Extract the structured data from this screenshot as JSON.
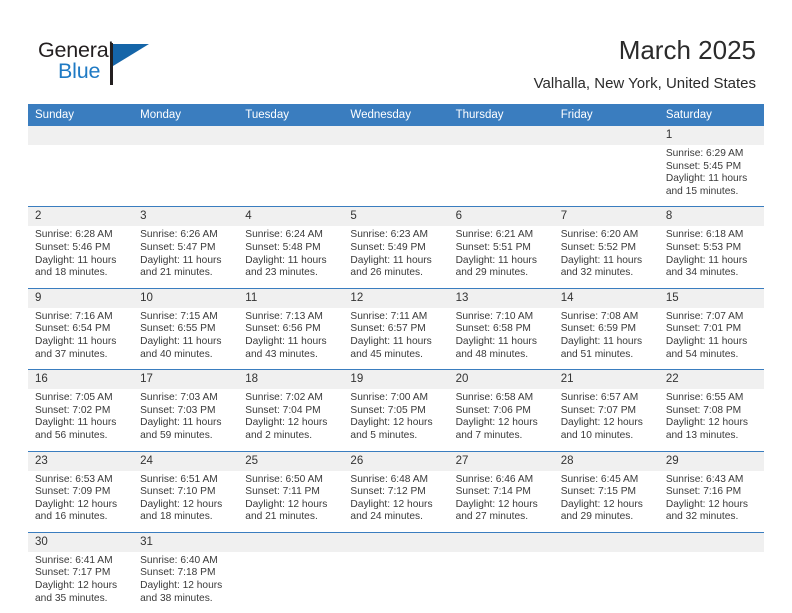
{
  "brand": {
    "name_top": "General",
    "name_bottom": "Blue",
    "accent_color": "#1f7ac4",
    "sail_icon": "sail-triangle-icon"
  },
  "header": {
    "title": "March 2025",
    "subtitle": "Valhalla, New York, United States"
  },
  "colors": {
    "header_row_bg": "#3a7dbf",
    "daynum_bg": "#f0f0f0",
    "text": "#3a3a3a",
    "grid_line": "#3a7dbf"
  },
  "calendar": {
    "weekday_headers": [
      "Sunday",
      "Monday",
      "Tuesday",
      "Wednesday",
      "Thursday",
      "Friday",
      "Saturday"
    ],
    "weeks": [
      [
        {
          "day": "",
          "empty": true
        },
        {
          "day": "",
          "empty": true
        },
        {
          "day": "",
          "empty": true
        },
        {
          "day": "",
          "empty": true
        },
        {
          "day": "",
          "empty": true
        },
        {
          "day": "",
          "empty": true
        },
        {
          "day": "1",
          "sunrise": "Sunrise: 6:29 AM",
          "sunset": "Sunset: 5:45 PM",
          "daylight": "Daylight: 11 hours and 15 minutes."
        }
      ],
      [
        {
          "day": "2",
          "sunrise": "Sunrise: 6:28 AM",
          "sunset": "Sunset: 5:46 PM",
          "daylight": "Daylight: 11 hours and 18 minutes."
        },
        {
          "day": "3",
          "sunrise": "Sunrise: 6:26 AM",
          "sunset": "Sunset: 5:47 PM",
          "daylight": "Daylight: 11 hours and 21 minutes."
        },
        {
          "day": "4",
          "sunrise": "Sunrise: 6:24 AM",
          "sunset": "Sunset: 5:48 PM",
          "daylight": "Daylight: 11 hours and 23 minutes."
        },
        {
          "day": "5",
          "sunrise": "Sunrise: 6:23 AM",
          "sunset": "Sunset: 5:49 PM",
          "daylight": "Daylight: 11 hours and 26 minutes."
        },
        {
          "day": "6",
          "sunrise": "Sunrise: 6:21 AM",
          "sunset": "Sunset: 5:51 PM",
          "daylight": "Daylight: 11 hours and 29 minutes."
        },
        {
          "day": "7",
          "sunrise": "Sunrise: 6:20 AM",
          "sunset": "Sunset: 5:52 PM",
          "daylight": "Daylight: 11 hours and 32 minutes."
        },
        {
          "day": "8",
          "sunrise": "Sunrise: 6:18 AM",
          "sunset": "Sunset: 5:53 PM",
          "daylight": "Daylight: 11 hours and 34 minutes."
        }
      ],
      [
        {
          "day": "9",
          "sunrise": "Sunrise: 7:16 AM",
          "sunset": "Sunset: 6:54 PM",
          "daylight": "Daylight: 11 hours and 37 minutes."
        },
        {
          "day": "10",
          "sunrise": "Sunrise: 7:15 AM",
          "sunset": "Sunset: 6:55 PM",
          "daylight": "Daylight: 11 hours and 40 minutes."
        },
        {
          "day": "11",
          "sunrise": "Sunrise: 7:13 AM",
          "sunset": "Sunset: 6:56 PM",
          "daylight": "Daylight: 11 hours and 43 minutes."
        },
        {
          "day": "12",
          "sunrise": "Sunrise: 7:11 AM",
          "sunset": "Sunset: 6:57 PM",
          "daylight": "Daylight: 11 hours and 45 minutes."
        },
        {
          "day": "13",
          "sunrise": "Sunrise: 7:10 AM",
          "sunset": "Sunset: 6:58 PM",
          "daylight": "Daylight: 11 hours and 48 minutes."
        },
        {
          "day": "14",
          "sunrise": "Sunrise: 7:08 AM",
          "sunset": "Sunset: 6:59 PM",
          "daylight": "Daylight: 11 hours and 51 minutes."
        },
        {
          "day": "15",
          "sunrise": "Sunrise: 7:07 AM",
          "sunset": "Sunset: 7:01 PM",
          "daylight": "Daylight: 11 hours and 54 minutes."
        }
      ],
      [
        {
          "day": "16",
          "sunrise": "Sunrise: 7:05 AM",
          "sunset": "Sunset: 7:02 PM",
          "daylight": "Daylight: 11 hours and 56 minutes."
        },
        {
          "day": "17",
          "sunrise": "Sunrise: 7:03 AM",
          "sunset": "Sunset: 7:03 PM",
          "daylight": "Daylight: 11 hours and 59 minutes."
        },
        {
          "day": "18",
          "sunrise": "Sunrise: 7:02 AM",
          "sunset": "Sunset: 7:04 PM",
          "daylight": "Daylight: 12 hours and 2 minutes."
        },
        {
          "day": "19",
          "sunrise": "Sunrise: 7:00 AM",
          "sunset": "Sunset: 7:05 PM",
          "daylight": "Daylight: 12 hours and 5 minutes."
        },
        {
          "day": "20",
          "sunrise": "Sunrise: 6:58 AM",
          "sunset": "Sunset: 7:06 PM",
          "daylight": "Daylight: 12 hours and 7 minutes."
        },
        {
          "day": "21",
          "sunrise": "Sunrise: 6:57 AM",
          "sunset": "Sunset: 7:07 PM",
          "daylight": "Daylight: 12 hours and 10 minutes."
        },
        {
          "day": "22",
          "sunrise": "Sunrise: 6:55 AM",
          "sunset": "Sunset: 7:08 PM",
          "daylight": "Daylight: 12 hours and 13 minutes."
        }
      ],
      [
        {
          "day": "23",
          "sunrise": "Sunrise: 6:53 AM",
          "sunset": "Sunset: 7:09 PM",
          "daylight": "Daylight: 12 hours and 16 minutes."
        },
        {
          "day": "24",
          "sunrise": "Sunrise: 6:51 AM",
          "sunset": "Sunset: 7:10 PM",
          "daylight": "Daylight: 12 hours and 18 minutes."
        },
        {
          "day": "25",
          "sunrise": "Sunrise: 6:50 AM",
          "sunset": "Sunset: 7:11 PM",
          "daylight": "Daylight: 12 hours and 21 minutes."
        },
        {
          "day": "26",
          "sunrise": "Sunrise: 6:48 AM",
          "sunset": "Sunset: 7:12 PM",
          "daylight": "Daylight: 12 hours and 24 minutes."
        },
        {
          "day": "27",
          "sunrise": "Sunrise: 6:46 AM",
          "sunset": "Sunset: 7:14 PM",
          "daylight": "Daylight: 12 hours and 27 minutes."
        },
        {
          "day": "28",
          "sunrise": "Sunrise: 6:45 AM",
          "sunset": "Sunset: 7:15 PM",
          "daylight": "Daylight: 12 hours and 29 minutes."
        },
        {
          "day": "29",
          "sunrise": "Sunrise: 6:43 AM",
          "sunset": "Sunset: 7:16 PM",
          "daylight": "Daylight: 12 hours and 32 minutes."
        }
      ],
      [
        {
          "day": "30",
          "sunrise": "Sunrise: 6:41 AM",
          "sunset": "Sunset: 7:17 PM",
          "daylight": "Daylight: 12 hours and 35 minutes."
        },
        {
          "day": "31",
          "sunrise": "Sunrise: 6:40 AM",
          "sunset": "Sunset: 7:18 PM",
          "daylight": "Daylight: 12 hours and 38 minutes."
        },
        {
          "day": "",
          "empty": true
        },
        {
          "day": "",
          "empty": true
        },
        {
          "day": "",
          "empty": true
        },
        {
          "day": "",
          "empty": true
        },
        {
          "day": "",
          "empty": true
        }
      ]
    ]
  }
}
